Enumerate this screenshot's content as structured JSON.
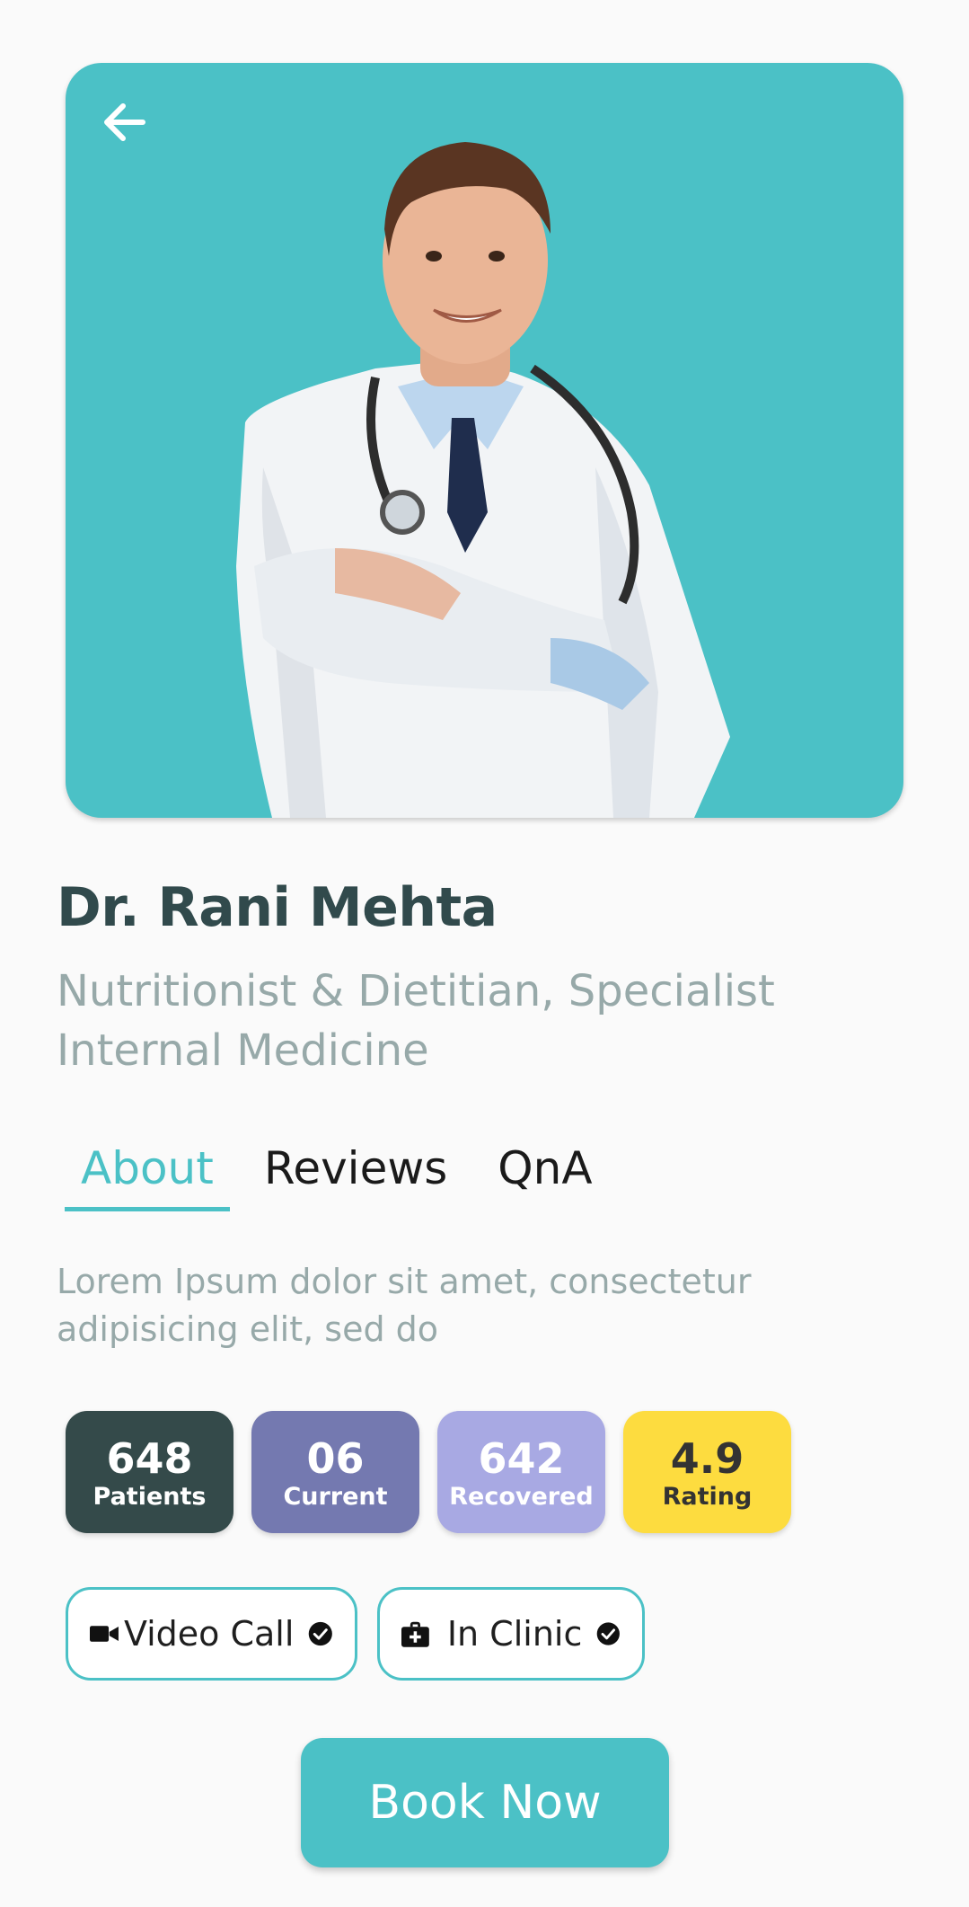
{
  "doctor": {
    "name": "Dr. Rani Mehta",
    "specialty": "Nutritionist & Dietitian, Specialist Internal Medicine"
  },
  "tabs": [
    {
      "label": "About",
      "active": true
    },
    {
      "label": "Reviews",
      "active": false
    },
    {
      "label": "QnA",
      "active": false
    }
  ],
  "about": {
    "text": "Lorem Ipsum dolor sit amet, consectetur adipisicing elit, sed do"
  },
  "stats": [
    {
      "value": "648",
      "label": "Patients",
      "bg": "#344a4a",
      "fg": "#ffffff"
    },
    {
      "value": "06",
      "label": "Current",
      "bg": "#7479b0",
      "fg": "#ffffff"
    },
    {
      "value": "642",
      "label": "Recovered",
      "bg": "#a8a9e3",
      "fg": "#ffffff"
    },
    {
      "value": "4.9",
      "label": "Rating",
      "bg": "#fddc3f",
      "fg": "#333333"
    }
  ],
  "modes": [
    {
      "label": "Video Call",
      "icon": "video-camera-icon",
      "checked": true
    },
    {
      "label": "In Clinic",
      "icon": "medical-bag-icon",
      "checked": true
    }
  ],
  "actions": {
    "book_label": "Book Now"
  },
  "colors": {
    "accent": "#4bc1c6",
    "name": "#314a4c",
    "muted": "#97a9a9"
  }
}
